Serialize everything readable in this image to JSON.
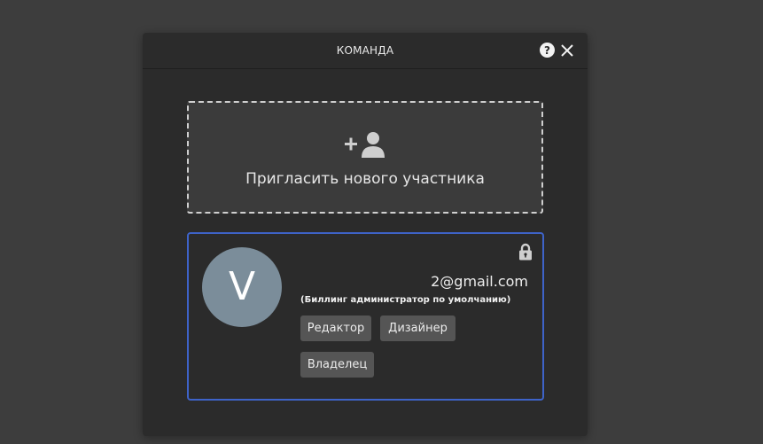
{
  "modal": {
    "title": "КОМАНДА",
    "help_icon": "question-circle-icon",
    "close_icon": "close-icon"
  },
  "invite": {
    "icon": "add-user-icon",
    "label": "Пригласить нового участника"
  },
  "member": {
    "avatar_letter": "V",
    "avatar_color": "#7b8d9a",
    "lock_icon": "lock-icon",
    "email": "2@gmail.com",
    "note": "(Биллинг администратор по умолчанию)",
    "roles": [
      {
        "label": "Редактор"
      },
      {
        "label": "Дизайнер"
      },
      {
        "label": "Владелец"
      }
    ],
    "card_border_color": "#3e63c8"
  }
}
